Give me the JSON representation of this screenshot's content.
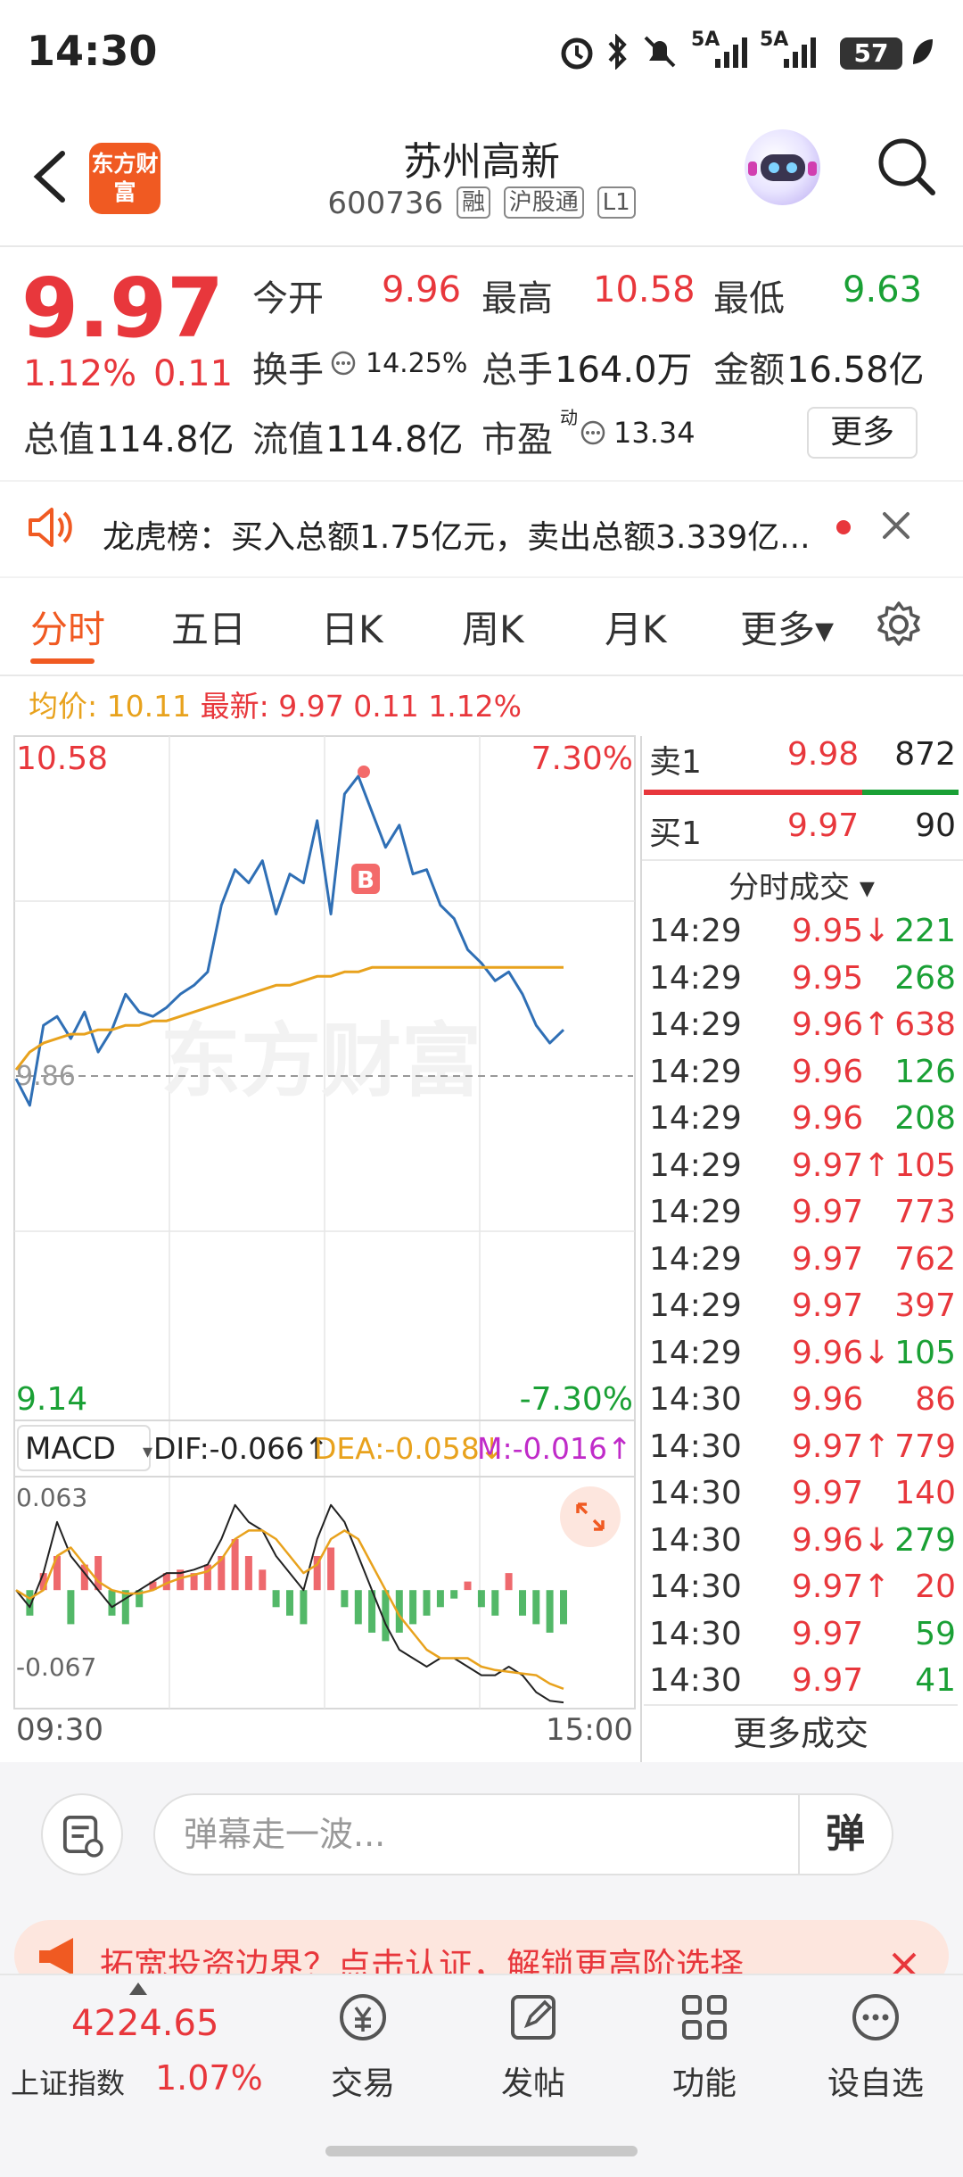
{
  "status_bar": {
    "time": "14:30",
    "signal1": "5A",
    "signal2": "5A",
    "battery": "57"
  },
  "header": {
    "title": "苏州高新",
    "code": "600736",
    "tags": [
      "融",
      "沪股通",
      "L1"
    ],
    "logo": "东方财富"
  },
  "quote": {
    "last_price": "9.97",
    "change_pct": "1.12%",
    "change_val": "0.11",
    "open_label": "今开",
    "open": "9.96",
    "high_label": "最高",
    "high": "10.58",
    "low_label": "最低",
    "low": "9.63",
    "turnover_label": "换手",
    "turnover": "14.25%",
    "volume_label": "总手",
    "volume": "164.0万",
    "amount_label": "金额",
    "amount": "16.58亿",
    "mktcap_label": "总值",
    "mktcap": "114.8亿",
    "float_label": "流值",
    "float": "114.8亿",
    "pe_label": "市盈",
    "pe_sup": "动",
    "pe": "13.34",
    "more_label": "更多"
  },
  "notice": {
    "text": "龙虎榜：买入总额1.75亿元，卖出总额3.339亿..."
  },
  "tabs": [
    {
      "label": "分时",
      "active": true
    },
    {
      "label": "五日"
    },
    {
      "label": "日K"
    },
    {
      "label": "周K"
    },
    {
      "label": "月K"
    },
    {
      "label": "更多▾"
    }
  ],
  "info_line": {
    "avg_label": "均价:",
    "avg": "10.11",
    "last_label": "最新:",
    "last": "9.97",
    "chg": "0.11",
    "pct": "1.12%"
  },
  "chart_data": {
    "type": "line",
    "title": "",
    "y_top": "10.58",
    "y_bottom": "9.14",
    "pct_top": "7.30%",
    "pct_bottom": "-7.30%",
    "prev_close": "9.86",
    "watermark": "东方财富",
    "x_start": "09:30",
    "x_end": "15:00",
    "ylim": [
      9.14,
      10.58
    ],
    "buy_marker": "B",
    "price_series": [
      9.86,
      9.8,
      9.98,
      10.0,
      9.95,
      10.01,
      9.92,
      9.97,
      10.05,
      10.01,
      10.0,
      10.02,
      10.05,
      10.07,
      10.1,
      10.25,
      10.33,
      10.3,
      10.35,
      10.23,
      10.32,
      10.3,
      10.44,
      10.23,
      10.5,
      10.54,
      10.46,
      10.38,
      10.43,
      10.32,
      10.33,
      10.25,
      10.22,
      10.15,
      10.12,
      10.08,
      10.1,
      10.05,
      9.98,
      9.94,
      9.97
    ],
    "avg_series": [
      9.88,
      9.92,
      9.94,
      9.95,
      9.96,
      9.96,
      9.97,
      9.97,
      9.98,
      9.98,
      9.99,
      9.99,
      10.0,
      10.01,
      10.02,
      10.03,
      10.04,
      10.05,
      10.06,
      10.07,
      10.07,
      10.08,
      10.09,
      10.09,
      10.1,
      10.1,
      10.11,
      10.11,
      10.11,
      10.11,
      10.11,
      10.11,
      10.11,
      10.11,
      10.11,
      10.11,
      10.11,
      10.11,
      10.11,
      10.11,
      10.11
    ],
    "macd": {
      "label": "MACD",
      "dif_label": "DIF:-0.066↑",
      "dea_label": "DEA:-0.058↓",
      "m_label": "M:-0.016↑",
      "top": "0.063",
      "bottom": "-0.067",
      "hist": [
        0.0,
        -0.015,
        0.01,
        0.02,
        -0.02,
        0.015,
        0.02,
        -0.015,
        -0.02,
        -0.01,
        0.005,
        0.01,
        0.012,
        0.01,
        0.015,
        0.02,
        0.03,
        0.02,
        0.012,
        -0.01,
        -0.015,
        -0.02,
        0.02,
        0.025,
        -0.01,
        -0.02,
        -0.025,
        -0.03,
        -0.025,
        -0.02,
        -0.015,
        -0.01,
        -0.005,
        0.005,
        -0.01,
        -0.015,
        0.01,
        -0.015,
        -0.02,
        -0.025,
        -0.02
      ],
      "dif": [
        0.0,
        -0.01,
        0.01,
        0.04,
        0.02,
        0.01,
        0.0,
        -0.01,
        -0.005,
        0.0,
        0.005,
        0.01,
        0.01,
        0.012,
        0.015,
        0.03,
        0.05,
        0.04,
        0.035,
        0.02,
        0.01,
        0.0,
        0.03,
        0.05,
        0.04,
        0.02,
        0.0,
        -0.02,
        -0.035,
        -0.04,
        -0.045,
        -0.04,
        -0.04,
        -0.045,
        -0.05,
        -0.05,
        -0.045,
        -0.05,
        -0.06,
        -0.065,
        -0.066
      ],
      "dea": [
        0.0,
        -0.005,
        0.0,
        0.02,
        0.025,
        0.015,
        0.005,
        0.0,
        -0.002,
        -0.002,
        0.0,
        0.004,
        0.007,
        0.009,
        0.011,
        0.018,
        0.03,
        0.035,
        0.035,
        0.03,
        0.02,
        0.01,
        0.015,
        0.03,
        0.035,
        0.03,
        0.015,
        0.0,
        -0.015,
        -0.025,
        -0.035,
        -0.04,
        -0.04,
        -0.04,
        -0.045,
        -0.047,
        -0.048,
        -0.049,
        -0.05,
        -0.055,
        -0.058
      ]
    }
  },
  "order_book": {
    "sell1_label": "卖1",
    "sell1_price": "9.98",
    "sell1_vol": "872",
    "buy1_label": "买1",
    "buy1_price": "9.97",
    "buy1_vol": "90",
    "trades_title": "分时成交 ▾",
    "trades": [
      {
        "t": "14:29",
        "p": "9.95↓",
        "v": "221",
        "c": "red",
        "vc": "green"
      },
      {
        "t": "14:29",
        "p": "9.95",
        "v": "268",
        "c": "red",
        "vc": "green"
      },
      {
        "t": "14:29",
        "p": "9.96↑",
        "v": "638",
        "c": "red",
        "vc": "red"
      },
      {
        "t": "14:29",
        "p": "9.96",
        "v": "126",
        "c": "red",
        "vc": "green"
      },
      {
        "t": "14:29",
        "p": "9.96",
        "v": "208",
        "c": "red",
        "vc": "green"
      },
      {
        "t": "14:29",
        "p": "9.97↑",
        "v": "105",
        "c": "red",
        "vc": "red"
      },
      {
        "t": "14:29",
        "p": "9.97",
        "v": "773",
        "c": "red",
        "vc": "red"
      },
      {
        "t": "14:29",
        "p": "9.97",
        "v": "762",
        "c": "red",
        "vc": "red"
      },
      {
        "t": "14:29",
        "p": "9.97",
        "v": "397",
        "c": "red",
        "vc": "red"
      },
      {
        "t": "14:29",
        "p": "9.96↓",
        "v": "105",
        "c": "red",
        "vc": "green"
      },
      {
        "t": "14:30",
        "p": "9.96",
        "v": "86",
        "c": "red",
        "vc": "red"
      },
      {
        "t": "14:30",
        "p": "9.97↑",
        "v": "779",
        "c": "red",
        "vc": "red"
      },
      {
        "t": "14:30",
        "p": "9.97",
        "v": "140",
        "c": "red",
        "vc": "red"
      },
      {
        "t": "14:30",
        "p": "9.96↓",
        "v": "279",
        "c": "red",
        "vc": "green"
      },
      {
        "t": "14:30",
        "p": "9.97↑",
        "v": "20",
        "c": "red",
        "vc": "red"
      },
      {
        "t": "14:30",
        "p": "9.97",
        "v": "59",
        "c": "red",
        "vc": "green"
      },
      {
        "t": "14:30",
        "p": "9.97",
        "v": "41",
        "c": "red",
        "vc": "green"
      }
    ],
    "more_trades": "更多成交"
  },
  "danmaku": {
    "placeholder": "弹幕走一波...",
    "toggle": "弹"
  },
  "promo": {
    "text": "拓宽投资边界？点击认证，解锁更高阶选择"
  },
  "bottom_nav": {
    "index_value": "4224.65",
    "index_name": "上证指数",
    "index_pct": "1.07%",
    "items": [
      {
        "label": "交易",
        "icon": "yuan-icon"
      },
      {
        "label": "发帖",
        "icon": "edit-icon"
      },
      {
        "label": "功能",
        "icon": "grid-icon"
      },
      {
        "label": "设自选",
        "icon": "more-icon"
      }
    ]
  },
  "colors": {
    "up": "#e8373c",
    "down": "#1aa035",
    "accent": "#f05a22",
    "price_line": "#2f6fb5",
    "avg_line": "#e8a21d"
  }
}
